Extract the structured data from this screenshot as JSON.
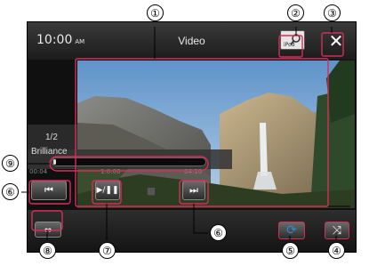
{
  "header": {
    "title": "Video",
    "time": "10:00",
    "ampm": "AM"
  },
  "source_icon": {
    "name": "ipod-icon",
    "label": "iPod"
  },
  "close_button": {
    "icon": "close-icon",
    "symbol": "✕"
  },
  "track": {
    "number": "1/2",
    "name": "Brilliance"
  },
  "playback": {
    "elapsed": "00:04",
    "middle": "1:0:00",
    "remaining": "04:10",
    "progress": 0.02
  },
  "controls": {
    "prev_symbol": "⏮",
    "play_pause_symbol": "▶/❚❚",
    "stop_symbol": "■",
    "next_symbol": "⏭",
    "repeat_symbol": "⟳",
    "shuffle_symbol": "⤨",
    "screen_mode_symbol": "⇔"
  },
  "callouts": {
    "c1": "①",
    "c2": "②",
    "c3": "③",
    "c4": "④",
    "c5": "⑤",
    "c6a": "⑥",
    "c6b": "⑥",
    "c7": "⑦",
    "c8": "⑧",
    "c9": "⑨"
  },
  "colors": {
    "highlight_frame": "#d62d5a",
    "repeat_active": "#2a8bd6"
  }
}
